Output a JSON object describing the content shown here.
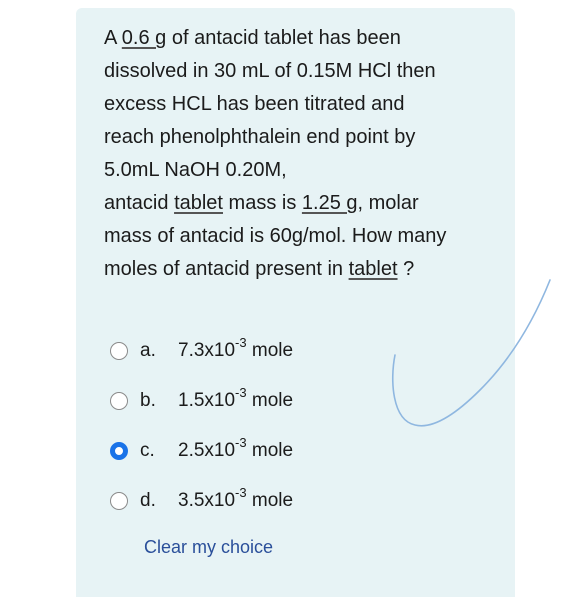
{
  "question": {
    "l1a": "A ",
    "l1u": "0.6 g",
    "l1b": " of antacid tablet has been",
    "l2": "dissolved in 30 mL of 0.15M HCl then",
    "l3": "excess HCL has been titrated and",
    "l4": "reach phenolphthalein end point by",
    "l5": "5.0mL NaOH 0.20M,",
    "l6a": "antacid ",
    "l6u1": "tablet",
    "l6b": " mass is ",
    "l6u2": "1.25 g",
    "l6c": ", molar",
    "l7": "mass of antacid is 60g/mol. How many",
    "l8a": "moles of antacid present in ",
    "l8u": "tablet",
    "l8b": " ?"
  },
  "options": [
    {
      "letter": "a.",
      "base": "7.3x10",
      "exp": "-3",
      "unit": " mole",
      "selected": false
    },
    {
      "letter": "b.",
      "base": "1.5x10",
      "exp": "-3",
      "unit": " mole",
      "selected": false
    },
    {
      "letter": "c.",
      "base": "2.5x10",
      "exp": "-3",
      "unit": " mole",
      "selected": true
    },
    {
      "letter": "d.",
      "base": "3.5x10",
      "exp": "-3",
      "unit": " mole",
      "selected": false
    }
  ],
  "clear_label": "Clear my choice",
  "colors": {
    "card_bg": "#e7f3f5",
    "radio_selected": "#1a73e8",
    "link": "#2a4f9a",
    "checkmark": "#8fb7e0"
  }
}
